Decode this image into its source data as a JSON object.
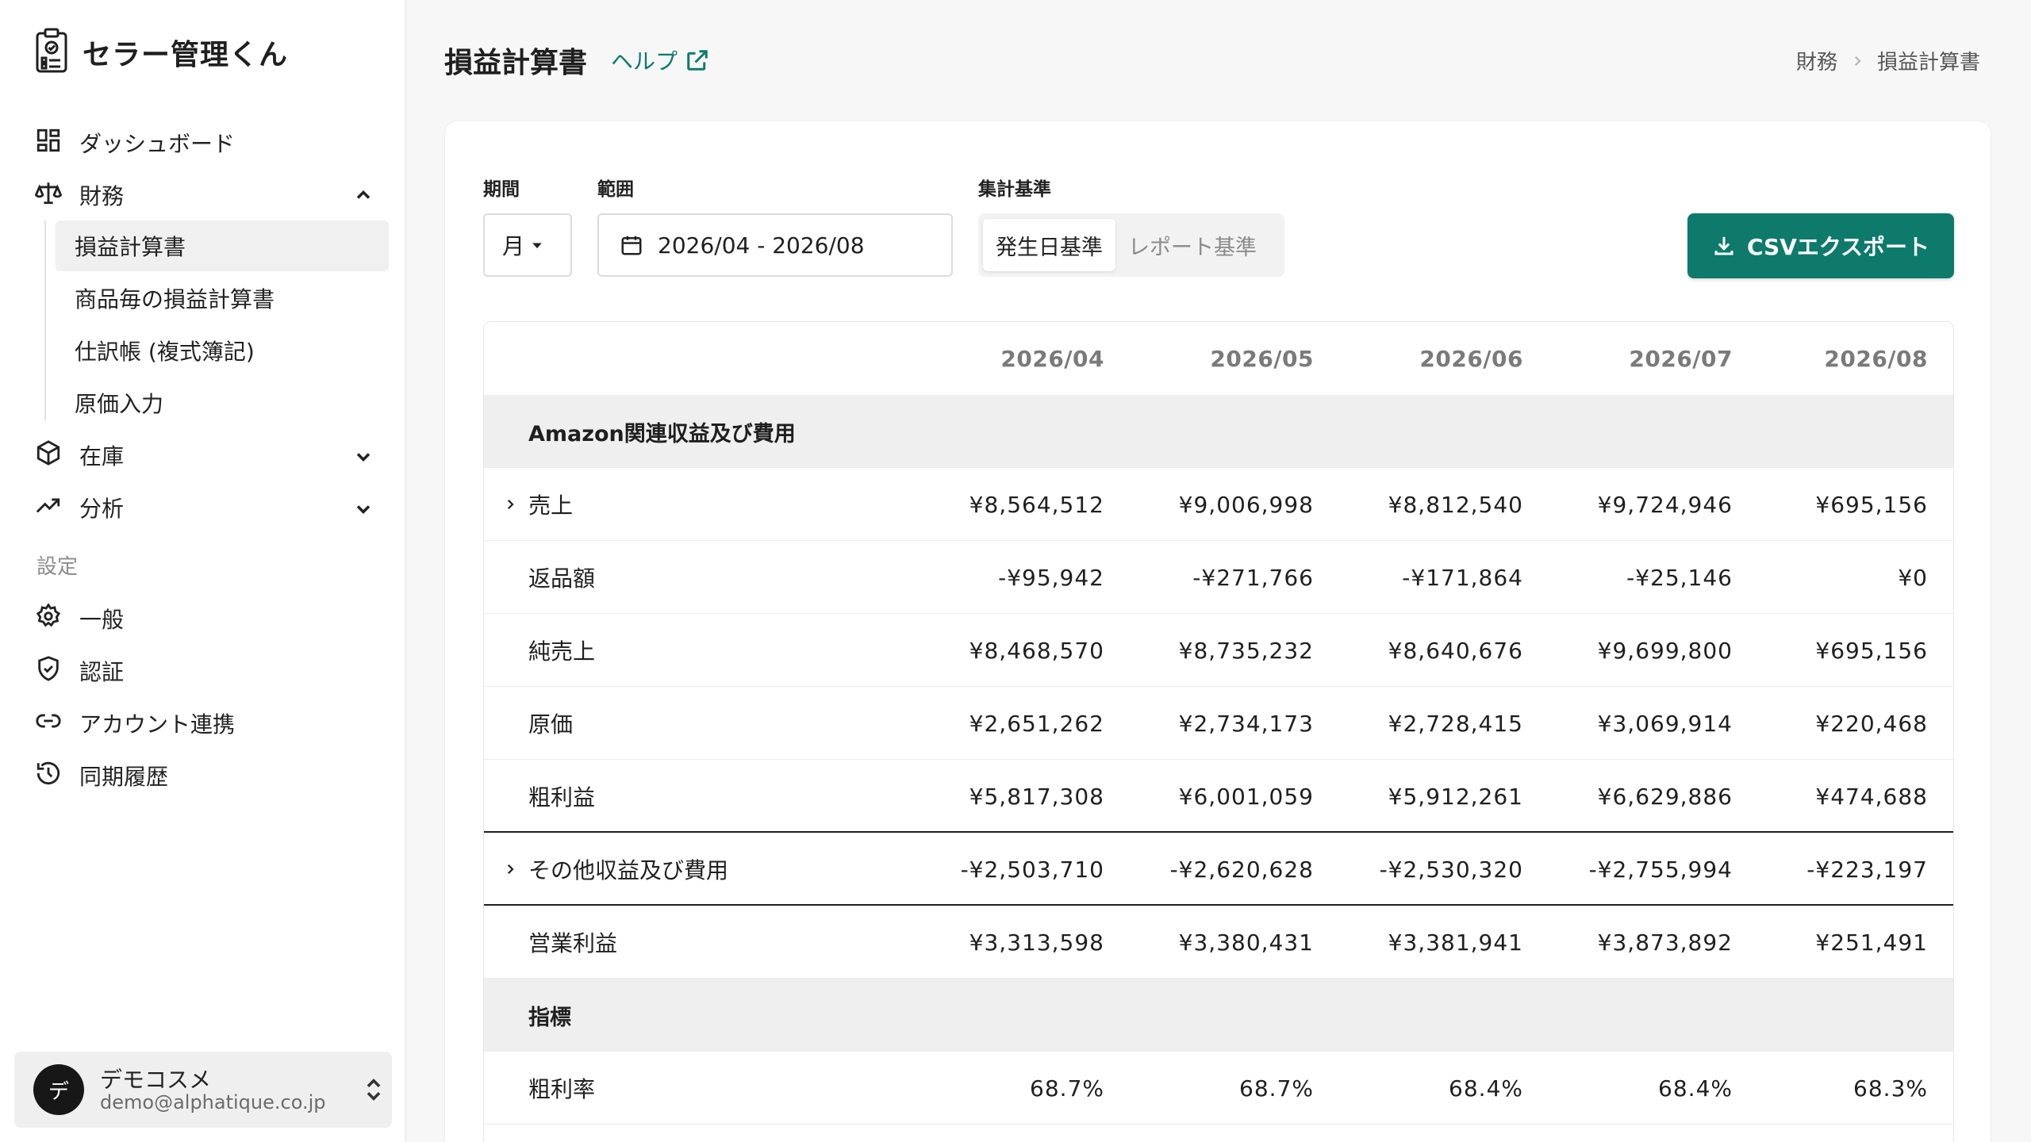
{
  "app": {
    "name": "セラー管理くん",
    "brand_color": "#0d7a6c"
  },
  "sidebar": {
    "items": [
      {
        "label": "ダッシュボード",
        "icon": "grid-icon"
      },
      {
        "label": "財務",
        "icon": "scale-icon",
        "expanded": true
      },
      {
        "label": "在庫",
        "icon": "box-icon",
        "expanded": false
      },
      {
        "label": "分析",
        "icon": "trending-up-icon",
        "expanded": false
      }
    ],
    "finance_sub": [
      {
        "label": "損益計算書",
        "active": true
      },
      {
        "label": "商品毎の損益計算書"
      },
      {
        "label": "仕訳帳 (複式簿記)"
      },
      {
        "label": "原価入力"
      }
    ],
    "settings_label": "設定",
    "settings_items": [
      {
        "label": "一般",
        "icon": "gear-icon"
      },
      {
        "label": "認証",
        "icon": "shield-icon"
      },
      {
        "label": "アカウント連携",
        "icon": "link-icon"
      },
      {
        "label": "同期履歴",
        "icon": "history-icon"
      }
    ],
    "user": {
      "avatar": "デ",
      "name": "デモコスメ",
      "email": "demo@alphatique.co.jp"
    }
  },
  "header": {
    "title": "損益計算書",
    "help": "ヘルプ",
    "breadcrumb": [
      "財務",
      "損益計算書"
    ]
  },
  "filters": {
    "period_label": "期間",
    "period_value": "月",
    "range_label": "範囲",
    "range_value": "2026/04 - 2026/08",
    "basis_label": "集計基準",
    "basis_options": [
      "発生日基準",
      "レポート基準"
    ],
    "basis_selected": "発生日基準",
    "export_label": "CSVエクスポート"
  },
  "table": {
    "columns": [
      "2026/04",
      "2026/05",
      "2026/06",
      "2026/07",
      "2026/08"
    ],
    "sections": [
      {
        "title": "Amazon関連収益及び費用"
      },
      {
        "title": "指標"
      }
    ],
    "rows": [
      {
        "label": "売上",
        "expandable": true,
        "values": [
          "¥8,564,512",
          "¥9,006,998",
          "¥8,812,540",
          "¥9,724,946",
          "¥695,156"
        ]
      },
      {
        "label": "返品額",
        "values": [
          "-¥95,942",
          "-¥271,766",
          "-¥171,864",
          "-¥25,146",
          "¥0"
        ]
      },
      {
        "label": "純売上",
        "values": [
          "¥8,468,570",
          "¥8,735,232",
          "¥8,640,676",
          "¥9,699,800",
          "¥695,156"
        ]
      },
      {
        "label": "原価",
        "values": [
          "¥2,651,262",
          "¥2,734,173",
          "¥2,728,415",
          "¥3,069,914",
          "¥220,468"
        ]
      },
      {
        "label": "粗利益",
        "values": [
          "¥5,817,308",
          "¥6,001,059",
          "¥5,912,261",
          "¥6,629,886",
          "¥474,688"
        ]
      },
      {
        "label": "その他収益及び費用",
        "expandable": true,
        "values": [
          "-¥2,503,710",
          "-¥2,620,628",
          "-¥2,530,320",
          "-¥2,755,994",
          "-¥223,197"
        ]
      },
      {
        "label": "営業利益",
        "values": [
          "¥3,313,598",
          "¥3,380,431",
          "¥3,381,941",
          "¥3,873,892",
          "¥251,491"
        ]
      },
      {
        "label": "粗利率",
        "values": [
          "68.7%",
          "68.7%",
          "68.4%",
          "68.4%",
          "68.3%"
        ]
      }
    ]
  }
}
